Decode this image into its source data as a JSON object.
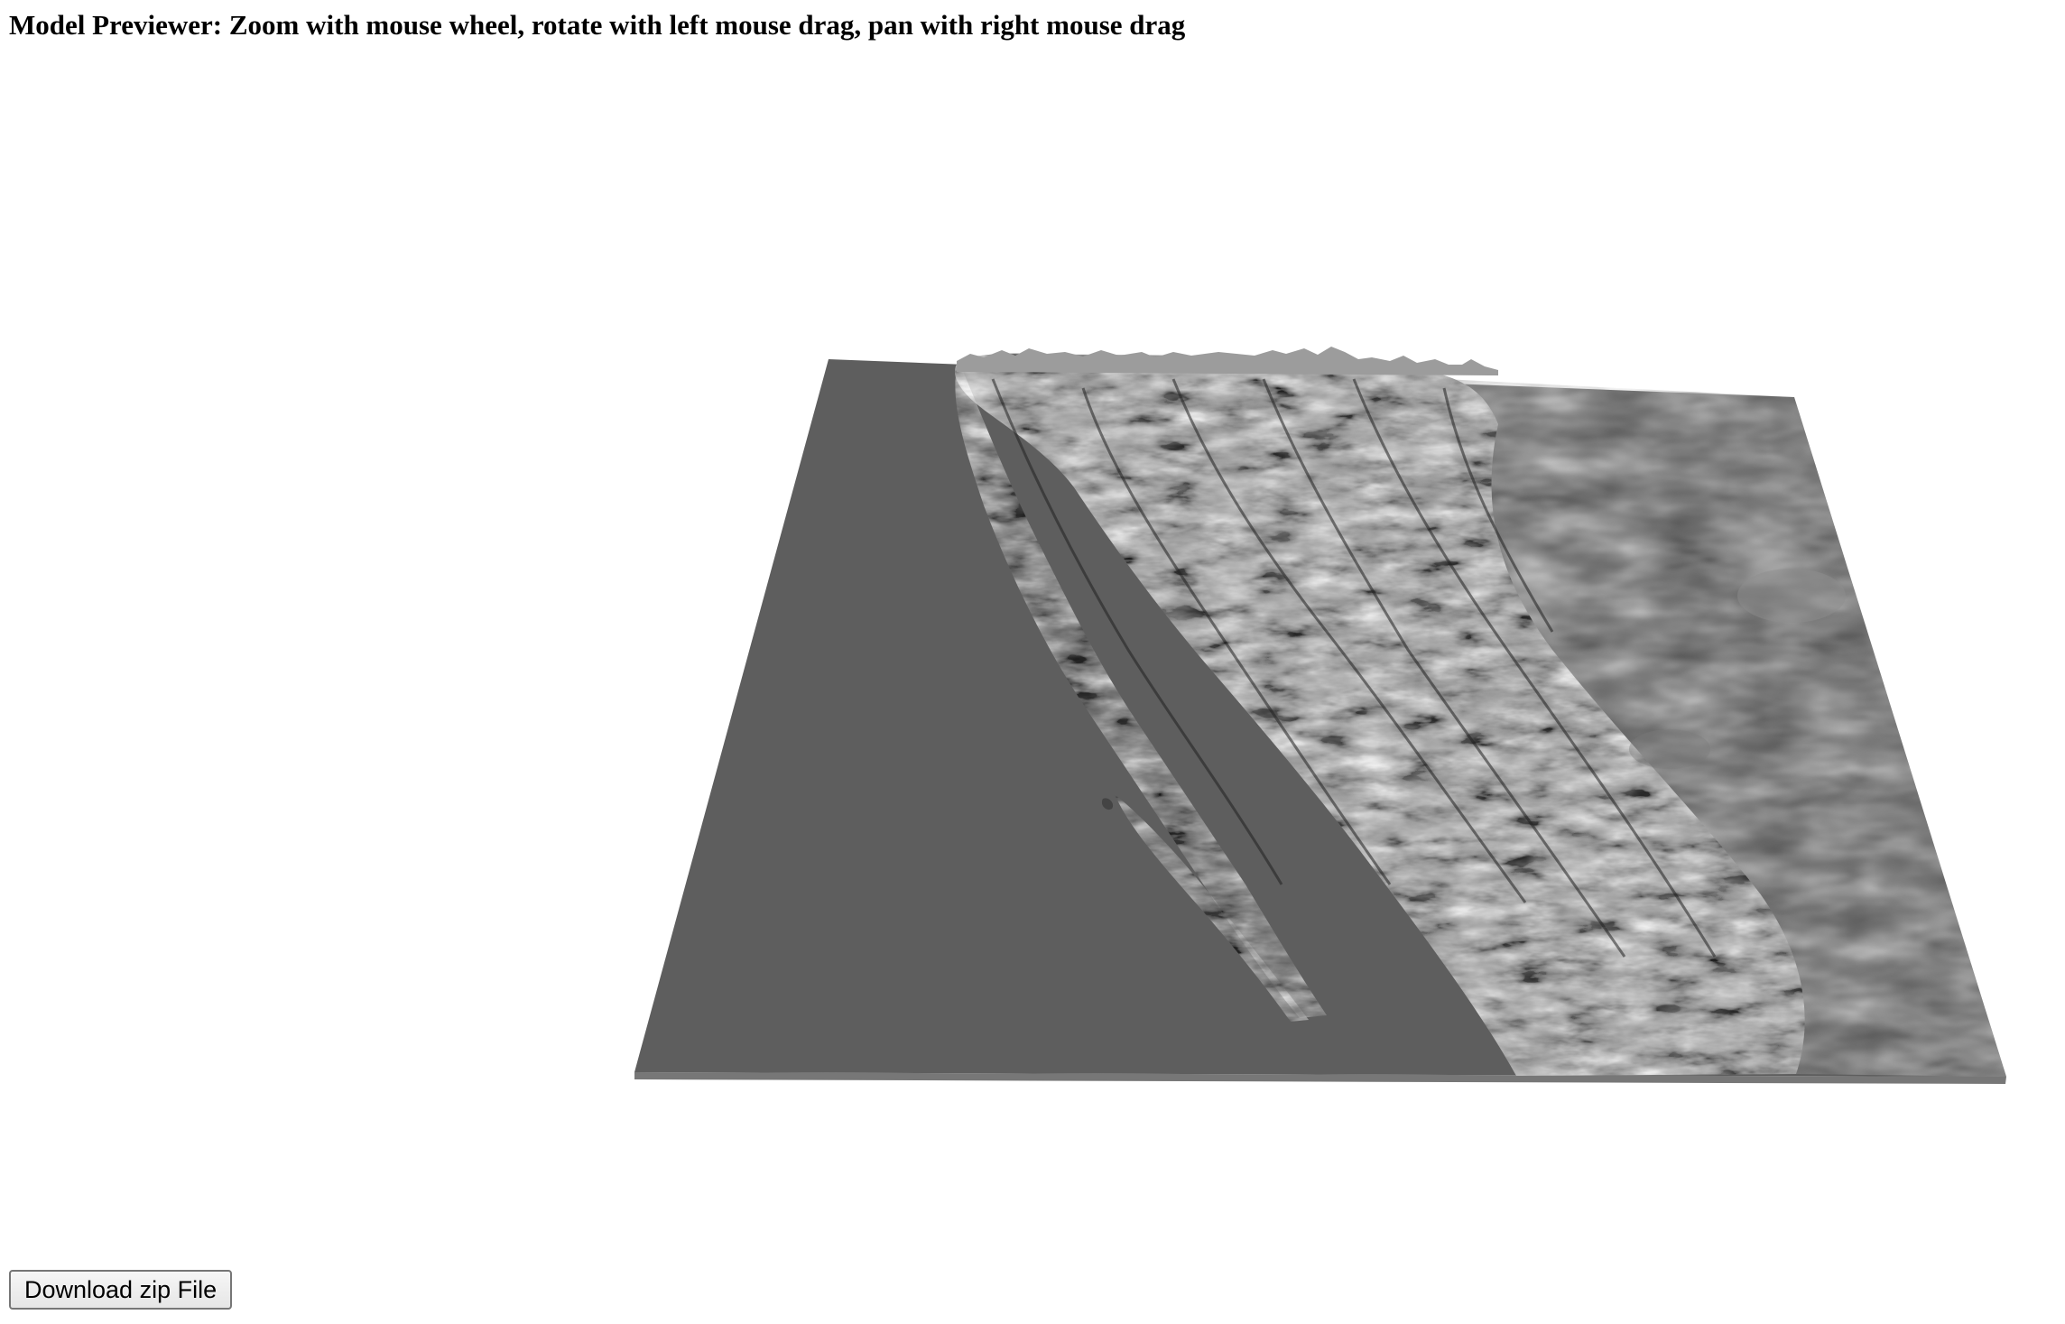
{
  "header": {
    "title": "Model Previewer: Zoom with mouse wheel, rotate with left mouse drag, pan with right mouse drag"
  },
  "viewer": {
    "model": "terrain-relief-mesh",
    "colors": {
      "background": "#ffffff",
      "base": "#5e5e5e",
      "edge": "#777777",
      "highlight": "#c8c8c8",
      "shadow": "#1e1e1e"
    }
  },
  "actions": {
    "download_label": "Download zip File"
  }
}
